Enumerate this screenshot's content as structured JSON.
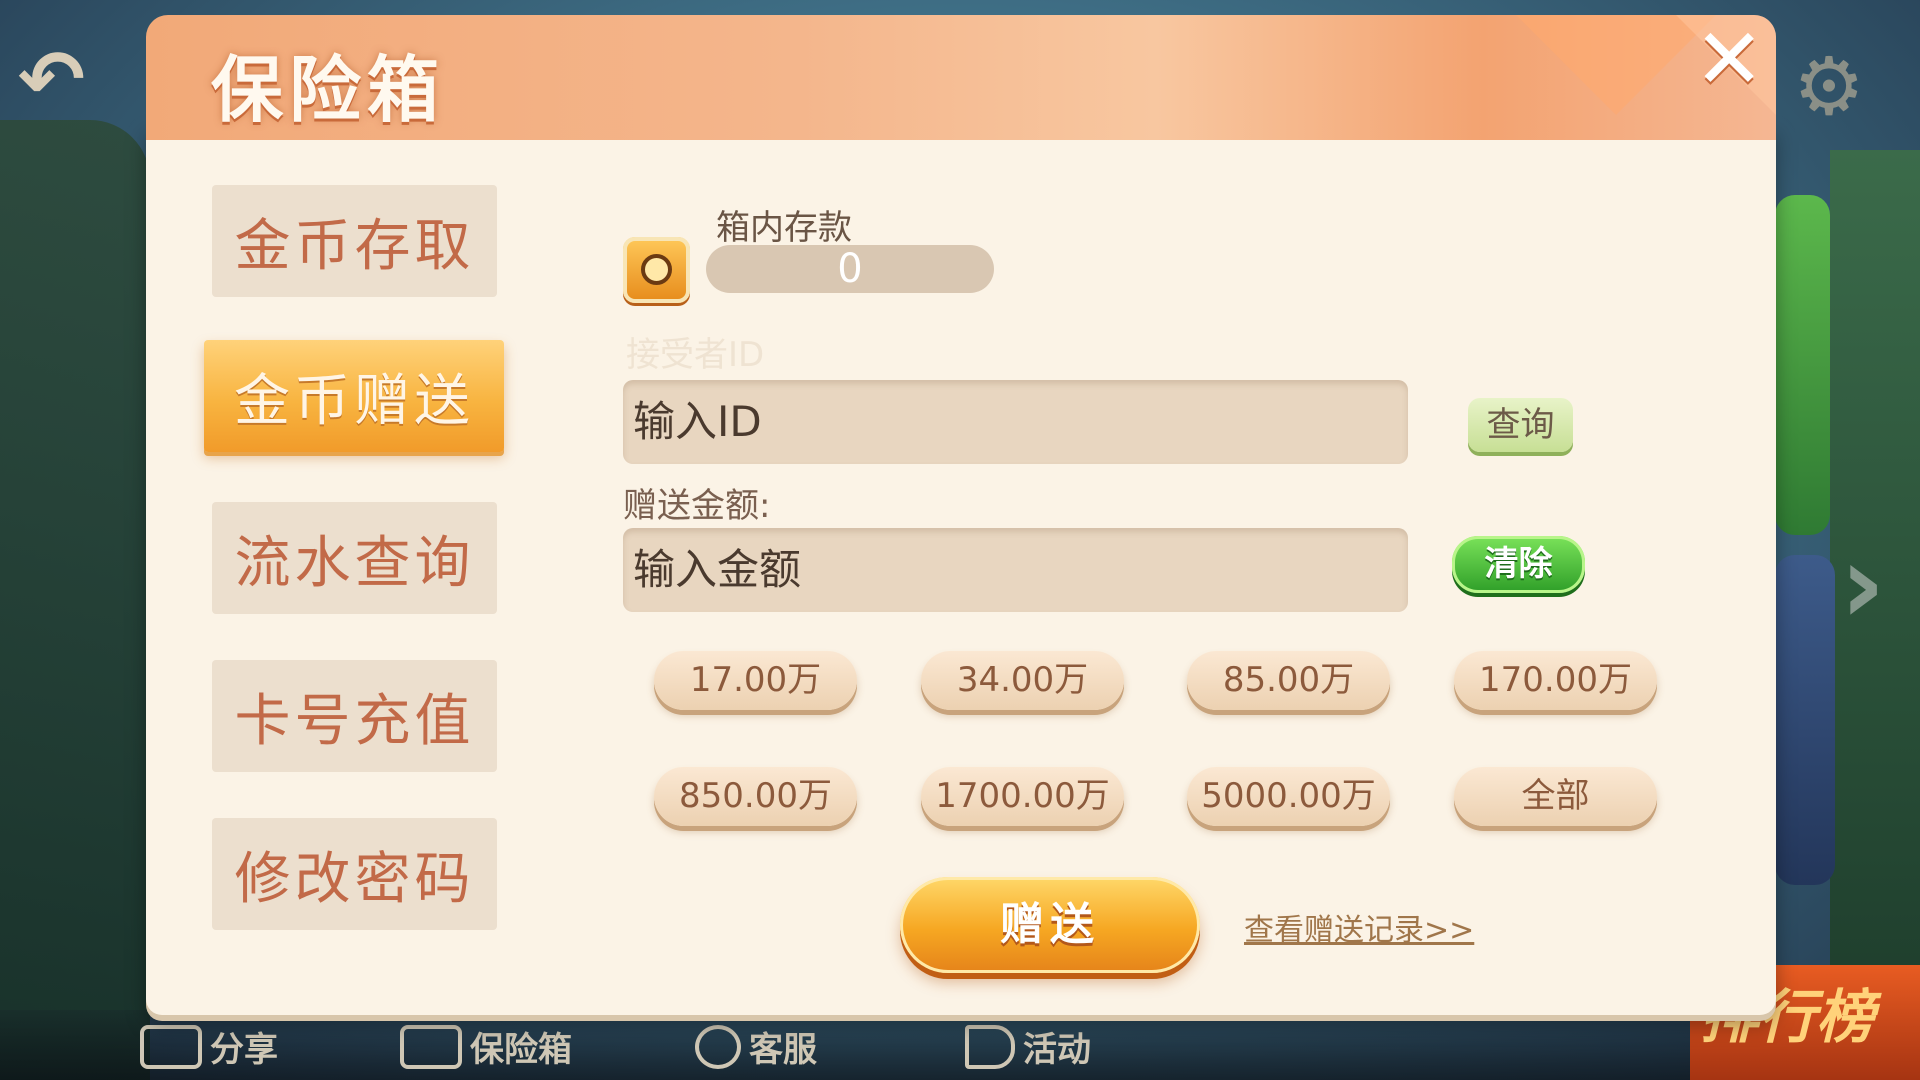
{
  "dialog": {
    "title": "保险箱",
    "close_icon": "close-icon"
  },
  "sidebar": {
    "items": [
      {
        "label": "金币存取",
        "active": false
      },
      {
        "label": "金币赠送",
        "active": true
      },
      {
        "label": "流水查询",
        "active": false
      },
      {
        "label": "卡号充值",
        "active": false
      },
      {
        "label": "修改密码",
        "active": false
      }
    ]
  },
  "form": {
    "safe_label": "箱内存款",
    "balance": "0",
    "receiver_label": "接受者ID",
    "id_placeholder": "输入ID",
    "query_label": "查询",
    "amount_label": "赠送金额:",
    "amount_placeholder": "输入金额",
    "clear_label": "清除",
    "amount_options": [
      "17.00万",
      "34.00万",
      "85.00万",
      "170.00万",
      "850.00万",
      "1700.00万",
      "5000.00万",
      "全部"
    ],
    "gift_label": "赠送",
    "record_link": "查看赠送记录>>"
  },
  "background": {
    "bottom_nav": [
      {
        "label": "分享",
        "icon": "share-icon"
      },
      {
        "label": "保险箱",
        "icon": "safe-icon"
      },
      {
        "label": "客服",
        "icon": "service-icon"
      },
      {
        "label": "活动",
        "icon": "megaphone-icon"
      }
    ],
    "rank_label": "排行榜",
    "back_icon": "back-arrow-icon",
    "settings_icon": "gear-icon"
  },
  "colors": {
    "header": "#f4b68c",
    "panel": "#fbf3e6",
    "sidebar_active": "#f8b440",
    "sidebar_text": "#c26a48",
    "green_button": "#2e9e28",
    "gift_button": "#f6a722"
  }
}
